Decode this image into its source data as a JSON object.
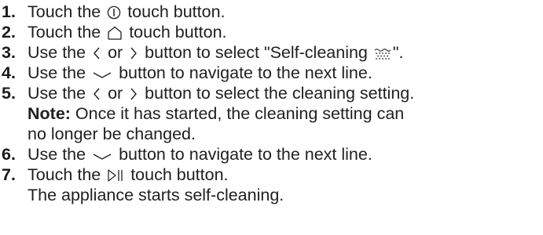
{
  "steps": [
    {
      "num": "1.",
      "pre": "Touch the",
      "icon": "power-icon",
      "post": "touch button."
    },
    {
      "num": "2.",
      "pre": "Touch the",
      "icon": "home-icon",
      "post": "touch button."
    },
    {
      "num": "3.",
      "pre": "Use the",
      "icon1": "chevron-left-icon",
      "mid": "or",
      "icon2": "chevron-right-icon",
      "post": "button to select \"Self-cleaning",
      "icon3": "self-cleaning-icon",
      "tail": "\"."
    },
    {
      "num": "4.",
      "pre": "Use the",
      "icon": "chevron-down-icon",
      "post": "button to navigate to the next line."
    },
    {
      "num": "5.",
      "pre": "Use the",
      "icon1": "chevron-left-icon",
      "mid": "or",
      "icon2": "chevron-right-icon",
      "post": "button to select the cleaning setting.",
      "note_label": "Note:",
      "note_line1": "Once it has started, the cleaning setting can",
      "note_line2": "no longer be changed."
    },
    {
      "num": "6.",
      "pre": "Use the",
      "icon": "chevron-down-icon",
      "post": "button to navigate to the next line."
    },
    {
      "num": "7.",
      "pre": "Touch the",
      "icon": "play-pause-icon",
      "post": "touch button.",
      "result": "The appliance starts self-cleaning."
    }
  ]
}
